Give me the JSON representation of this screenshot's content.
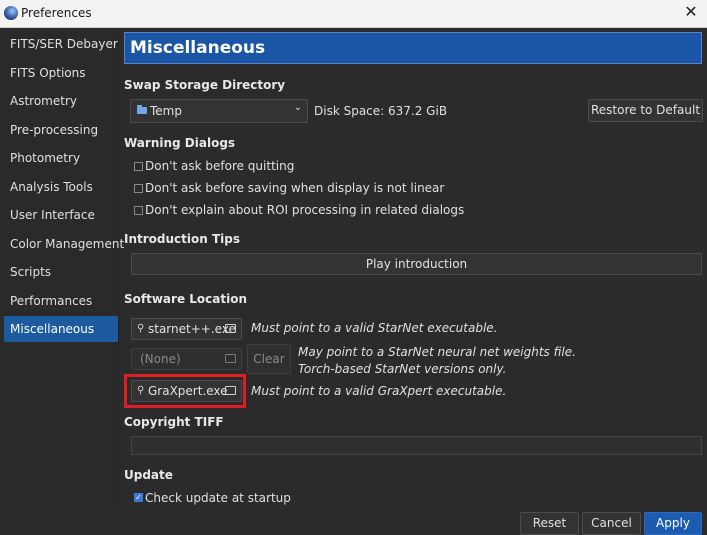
{
  "window": {
    "title": "Preferences",
    "close_glyph": "✕",
    "app_icon": "siril-icon"
  },
  "sidebar": {
    "items": [
      {
        "label": "FITS/SER Debayer",
        "active": false
      },
      {
        "label": "FITS Options",
        "active": false
      },
      {
        "label": "Astrometry",
        "active": false
      },
      {
        "label": "Pre-processing",
        "active": false
      },
      {
        "label": "Photometry",
        "active": false
      },
      {
        "label": "Analysis Tools",
        "active": false
      },
      {
        "label": "User Interface",
        "active": false
      },
      {
        "label": "Color Management",
        "active": false
      },
      {
        "label": "Scripts",
        "active": false
      },
      {
        "label": "Performances",
        "active": false
      },
      {
        "label": "Miscellaneous",
        "active": true
      }
    ]
  },
  "main": {
    "header": "Miscellaneous",
    "swap": {
      "title": "Swap Storage Directory",
      "directory": "Temp",
      "disk_space": "Disk Space: 637.2 GiB",
      "restore_label": "Restore to Default"
    },
    "warnings": {
      "title": "Warning Dialogs",
      "items": [
        {
          "label": "Don't ask before quitting",
          "checked": false
        },
        {
          "label": "Don't ask before saving when display is not linear",
          "checked": false
        },
        {
          "label": "Don't explain about ROI processing in related dialogs",
          "checked": false
        }
      ]
    },
    "intro": {
      "title": "Introduction Tips",
      "play_label": "Play introduction"
    },
    "software": {
      "title": "Software Location",
      "starnet_exe": "starnet++.exe",
      "starnet_note": "Must point to a valid StarNet executable.",
      "weights_file": "(None)",
      "clear_label": "Clear",
      "weights_note_line1": "May point to a StarNet neural net weights file.",
      "weights_note_line2": "Torch-based StarNet versions only.",
      "graxpert_exe": "GraXpert.exe",
      "graxpert_note": "Must point to a valid GraXpert executable."
    },
    "copyright": {
      "title": "Copyright TIFF",
      "value": ""
    },
    "update": {
      "title": "Update",
      "check_label": "Check update at startup",
      "checked": true
    }
  },
  "footer": {
    "reset_label": "Reset",
    "cancel_label": "Cancel",
    "apply_label": "Apply"
  },
  "colors": {
    "accent": "#1b55a6",
    "highlight": "#e01e26",
    "background": "#2b2b2b"
  }
}
